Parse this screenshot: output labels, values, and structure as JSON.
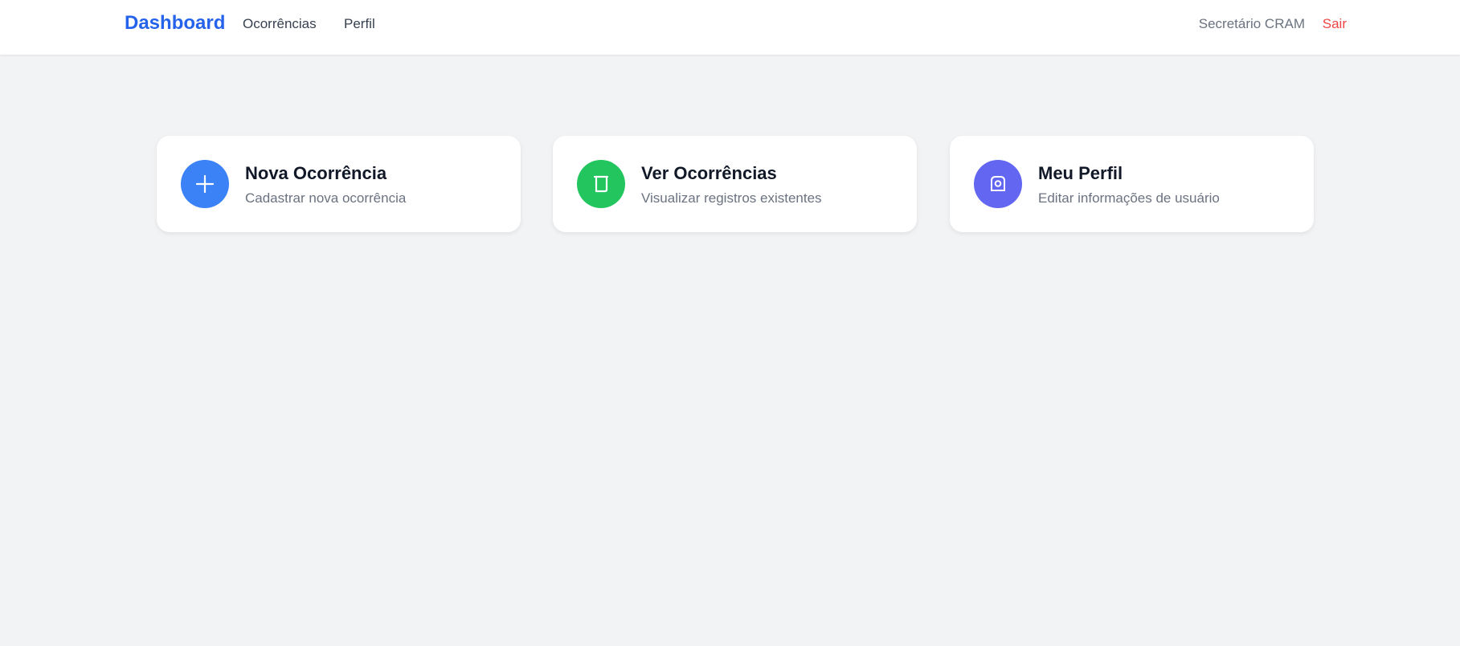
{
  "navbar": {
    "brand": "Dashboard",
    "links": [
      {
        "label": "Ocorrências"
      },
      {
        "label": "Perfil"
      }
    ],
    "user_name": "Secretário CRAM",
    "logout_label": "Sair"
  },
  "cards": [
    {
      "title": "Nova Ocorrência",
      "description": "Cadastrar nova ocorrência",
      "icon": "plus-icon",
      "color": "#3b82f6"
    },
    {
      "title": "Ver Ocorrências",
      "description": "Visualizar registros existentes",
      "icon": "document-icon",
      "color": "#22c55e"
    },
    {
      "title": "Meu Perfil",
      "description": "Editar informações de usuário",
      "icon": "user-icon",
      "color": "#6366f1"
    }
  ],
  "colors": {
    "brand": "#2563eb",
    "background": "#f2f3f5",
    "logout": "#ef4444"
  }
}
